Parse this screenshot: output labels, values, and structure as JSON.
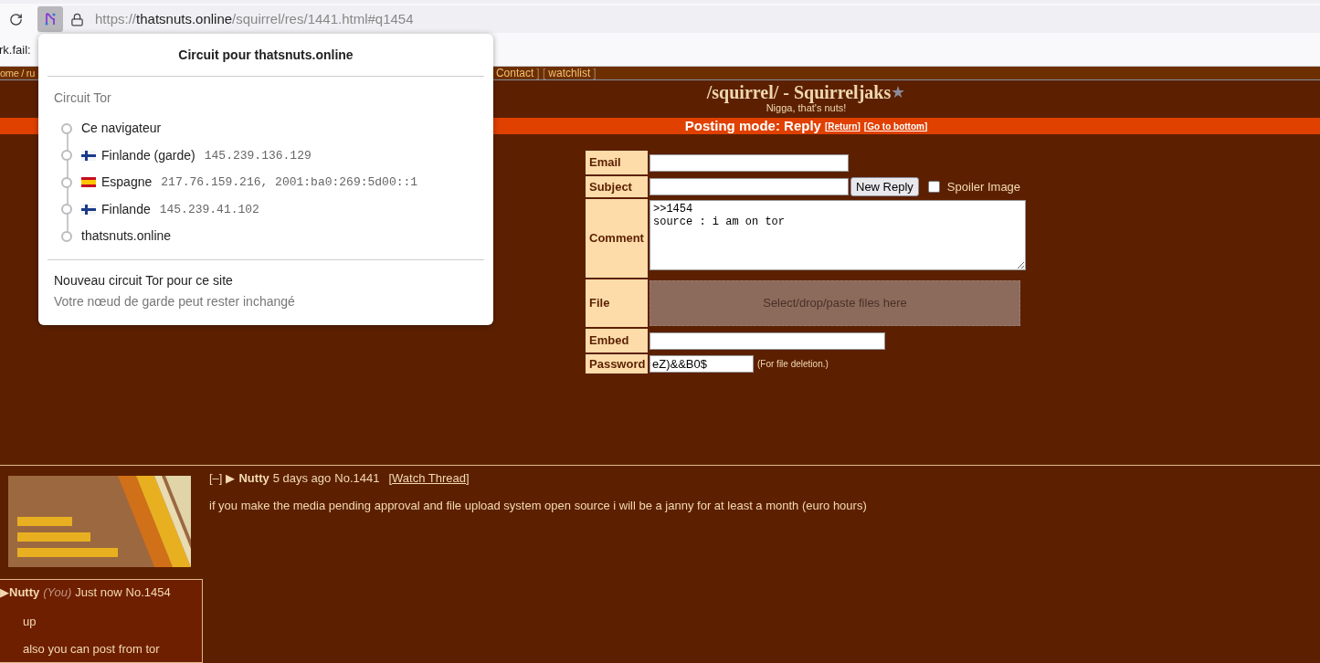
{
  "browser": {
    "url": {
      "scheme": "https://",
      "host": "thatsnuts.online",
      "path": "/squirrel/res/1441.html#q1454"
    },
    "bookmark": "rk.fail:"
  },
  "circuit_popup": {
    "title": "Circuit pour thatsnuts.online",
    "section": "Circuit Tor",
    "nodes": [
      {
        "name": "Ce navigateur"
      },
      {
        "name": "Finlande (garde)",
        "kind": "finland",
        "ip": "145.239.136.129"
      },
      {
        "name": "Espagne",
        "kind": "spain",
        "ip": "217.76.159.216, 2001:ba0:269:5d00::1"
      },
      {
        "name": "Finlande",
        "kind": "finland",
        "ip": "145.239.41.102"
      },
      {
        "name": "thatsnuts.online"
      }
    ],
    "new_circuit": "Nouveau circuit Tor pour ce site",
    "note": "Votre nœud de garde peut rester inchangé"
  },
  "nav": {
    "left": "ome / ru",
    "right": [
      {
        "kind": "link",
        "text": "Contact"
      },
      {
        "kind": "bracket",
        "text": "] ["
      },
      {
        "kind": "link",
        "text": "watchlist"
      },
      {
        "kind": "bracket",
        "text": "]"
      }
    ]
  },
  "board": {
    "title": "/squirrel/ - Squirreljaks",
    "star": "★",
    "subtitle": "Nigga, that's nuts!"
  },
  "posting_bar": {
    "label": "Posting mode: Reply",
    "links": [
      "[Return]",
      "[Go to bottom]"
    ]
  },
  "form": [
    {
      "kind": "text",
      "label": "Email"
    },
    {
      "kind": "subject",
      "label": "Subject",
      "button": "New Reply",
      "checkbox": {
        "label": "Spoiler Image",
        "checked": false
      }
    },
    {
      "kind": "textarea",
      "label": "Comment",
      "value": ">>1454\nsource : i am on tor"
    },
    {
      "kind": "file",
      "label": "File",
      "placeholder": "Select/drop/paste files here"
    },
    {
      "kind": "wide",
      "label": "Embed"
    },
    {
      "kind": "password",
      "label": "Password",
      "value": "eZ)&&B0$",
      "note": "(For file deletion.)"
    }
  ],
  "op": {
    "toggle": "[–]",
    "marker": "▶",
    "name": "Nutty",
    "time": "5 days ago",
    "number": "No.1441",
    "watch": "[Watch Thread]",
    "body": "if you make the media pending approval and file upload system open source i will be a janny for at least a month (euro hours)"
  },
  "reply": {
    "marker": "▶",
    "name": "Nutty",
    "you": "(You)",
    "time": "Just now",
    "number": "No.1454",
    "lines": [
      "up",
      "also you can post from tor"
    ]
  }
}
